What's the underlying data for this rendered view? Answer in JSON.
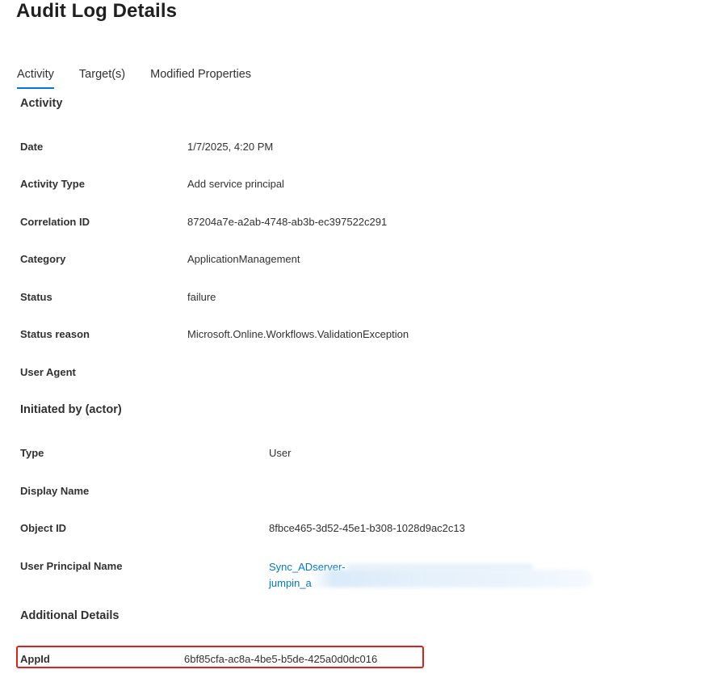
{
  "page": {
    "title": "Audit Log Details"
  },
  "tabs": [
    {
      "label": "Activity",
      "active": true
    },
    {
      "label": "Target(s)",
      "active": false
    },
    {
      "label": "Modified Properties",
      "active": false
    }
  ],
  "activity": {
    "header": "Activity",
    "rows": [
      {
        "label": "Date",
        "value": "1/7/2025, 4:20 PM"
      },
      {
        "label": "Activity Type",
        "value": "Add service principal"
      },
      {
        "label": "Correlation ID",
        "value": "87204a7e-a2ab-4748-ab3b-ec397522c291"
      },
      {
        "label": "Category",
        "value": "ApplicationManagement"
      },
      {
        "label": "Status",
        "value": "failure"
      },
      {
        "label": "Status reason",
        "value": "Microsoft.Online.Workflows.ValidationException"
      },
      {
        "label": "User Agent",
        "value": ""
      }
    ]
  },
  "initiated_by": {
    "header": "Initiated by (actor)",
    "rows": [
      {
        "label": "Type",
        "value": "User"
      },
      {
        "label": "Display Name",
        "value": ""
      },
      {
        "label": "Object ID",
        "value": "8fbce465-3d52-45e1-b308-1028d9ac2c13"
      },
      {
        "label": "User Principal Name",
        "value_line1": "Sync_ADserver-",
        "value_line2": "jumpin_a"
      }
    ]
  },
  "additional_details": {
    "header": "Additional Details",
    "rows": [
      {
        "label": "AppId",
        "value": "6bf85cfa-ac8a-4be5-b5de-425a0d0dc016"
      }
    ]
  },
  "colors": {
    "accent": "#0078d4",
    "highlight": "#e0201b"
  }
}
